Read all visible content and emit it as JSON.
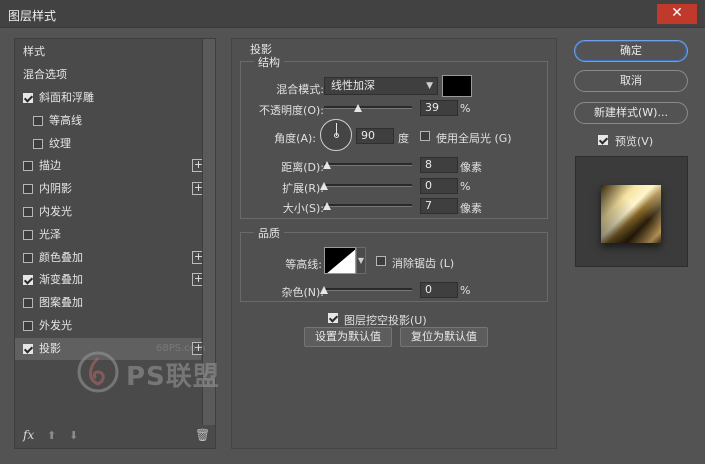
{
  "window": {
    "title": "图层样式",
    "close_glyph": "✕"
  },
  "left": {
    "header": "样式",
    "blend_options": "混合选项",
    "items": [
      {
        "label": "斜面和浮雕",
        "checked": true,
        "plus": false,
        "indent": 0
      },
      {
        "label": "等高线",
        "checked": false,
        "plus": false,
        "indent": 1
      },
      {
        "label": "纹理",
        "checked": false,
        "plus": false,
        "indent": 1
      },
      {
        "label": "描边",
        "checked": false,
        "plus": true,
        "indent": 0
      },
      {
        "label": "内阴影",
        "checked": false,
        "plus": true,
        "indent": 0
      },
      {
        "label": "内发光",
        "checked": false,
        "plus": false,
        "indent": 0
      },
      {
        "label": "光泽",
        "checked": false,
        "plus": false,
        "indent": 0
      },
      {
        "label": "颜色叠加",
        "checked": false,
        "plus": true,
        "indent": 0
      },
      {
        "label": "渐变叠加",
        "checked": true,
        "plus": true,
        "indent": 0
      },
      {
        "label": "图案叠加",
        "checked": false,
        "plus": false,
        "indent": 0
      },
      {
        "label": "外发光",
        "checked": false,
        "plus": false,
        "indent": 0
      },
      {
        "label": "投影",
        "checked": true,
        "plus": true,
        "indent": 0,
        "selected": true
      }
    ],
    "footer": {
      "fx": "fx",
      "up": "⬆",
      "down": "⬇",
      "trash": "🗑"
    }
  },
  "main": {
    "section_title": "投影",
    "structure": {
      "title": "结构",
      "blend_mode_label": "混合模式:",
      "blend_mode_value": "线性加深",
      "opacity_label": "不透明度(O):",
      "opacity_value": "39",
      "opacity_unit": "%",
      "opacity_fraction": 0.39,
      "angle_label": "角度(A):",
      "angle_value": "90",
      "angle_unit": "度",
      "global_light_label": "使用全局光 (G)",
      "global_light_checked": false,
      "distance_label": "距离(D):",
      "distance_value": "8",
      "distance_unit": "像素",
      "distance_fraction": 0.03,
      "spread_label": "扩展(R):",
      "spread_value": "0",
      "spread_unit": "%",
      "spread_fraction": 0.0,
      "size_label": "大小(S):",
      "size_value": "7",
      "size_unit": "像素",
      "size_fraction": 0.03
    },
    "quality": {
      "title": "品质",
      "contour_label": "等高线:",
      "antialias_label": "消除锯齿 (L)",
      "antialias_checked": false,
      "noise_label": "杂色(N):",
      "noise_value": "0",
      "noise_unit": "%",
      "noise_fraction": 0.0
    },
    "knockout_label": "图层挖空投影(U)",
    "knockout_checked": true,
    "set_default_label": "设置为默认值",
    "reset_default_label": "复位为默认值"
  },
  "right": {
    "ok_label": "确定",
    "cancel_label": "取消",
    "new_style_label": "新建样式(W)...",
    "preview_label": "预览(V)",
    "preview_checked": true
  },
  "watermark": {
    "site": "68PS.com",
    "name": "PS联盟"
  },
  "colors": {
    "shadow_color": "#000000",
    "accent": "#6fa0e8"
  }
}
